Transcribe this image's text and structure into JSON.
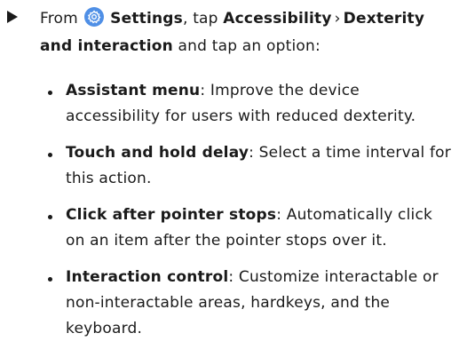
{
  "step": {
    "from": "From",
    "settings_label": "Settings",
    "tap": ", tap",
    "accessibility": "Accessibility",
    "separator": "›",
    "dexterity": "Dexterity and interaction",
    "tail": "and tap an option:",
    "icon": "settings-gear-icon"
  },
  "options": [
    {
      "title": "Assistant menu",
      "desc": ": Improve the device accessibility for users with reduced dexterity."
    },
    {
      "title": "Touch and hold delay",
      "desc": ": Select a time interval for this action."
    },
    {
      "title": "Click after pointer stops",
      "desc": ": Automatically click on an item after the pointer stops over it."
    },
    {
      "title": "Interaction control",
      "desc": ": Customize interactable or non-interactable areas, hardkeys, and the keyboard."
    }
  ],
  "colors": {
    "text": "#1a1a1a",
    "settings_icon": "#4f8fe6"
  }
}
